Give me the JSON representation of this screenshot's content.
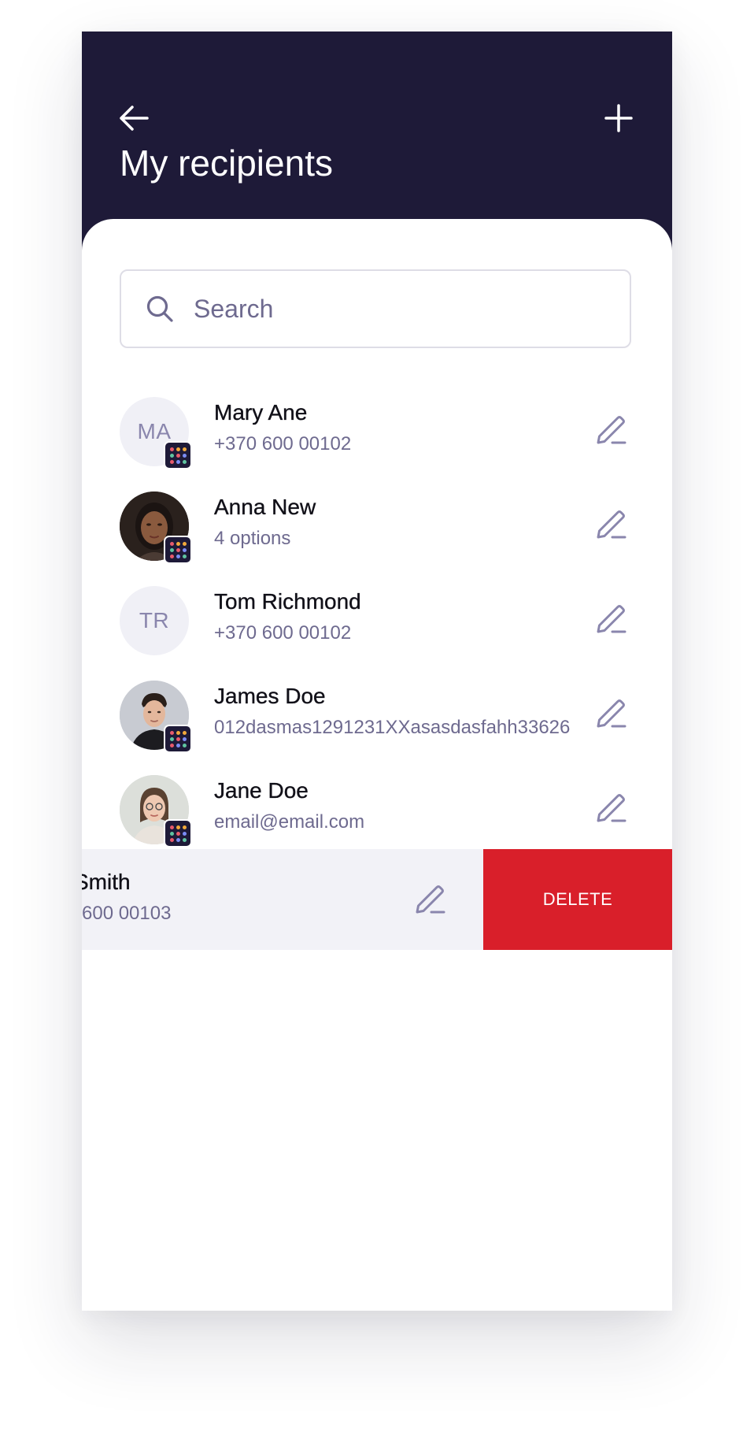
{
  "header": {
    "title": "My recipients",
    "back_icon": "arrow-left-icon",
    "add_icon": "plus-icon",
    "background": "#1e1a38"
  },
  "search": {
    "placeholder": "Search",
    "value": "",
    "icon": "search-icon"
  },
  "recipients": [
    {
      "name": "Mary Ane",
      "detail": "+370 600 00102",
      "initials": "MA",
      "avatar": "initials",
      "badge": true
    },
    {
      "name": "Anna New",
      "detail": "4 options",
      "avatar": "photo",
      "badge": true
    },
    {
      "name": "Tom Richmond",
      "detail": "+370 600 00102",
      "initials": "TR",
      "avatar": "initials",
      "badge": false
    },
    {
      "name": "James Doe",
      "detail": "012dasmas1291231XXasasdasfahh33626",
      "avatar": "photo",
      "badge": true
    },
    {
      "name": "Jane Doe",
      "detail": "email@email.com",
      "avatar": "photo",
      "badge": true
    }
  ],
  "swiped_row": {
    "name": "Smith",
    "detail": "600 00103",
    "delete_label": "DELETE"
  },
  "colors": {
    "accent": "#8a86ad",
    "secondary_text": "#6e6a8f",
    "delete": "#d91f2a",
    "badge": "#1e1a38"
  }
}
